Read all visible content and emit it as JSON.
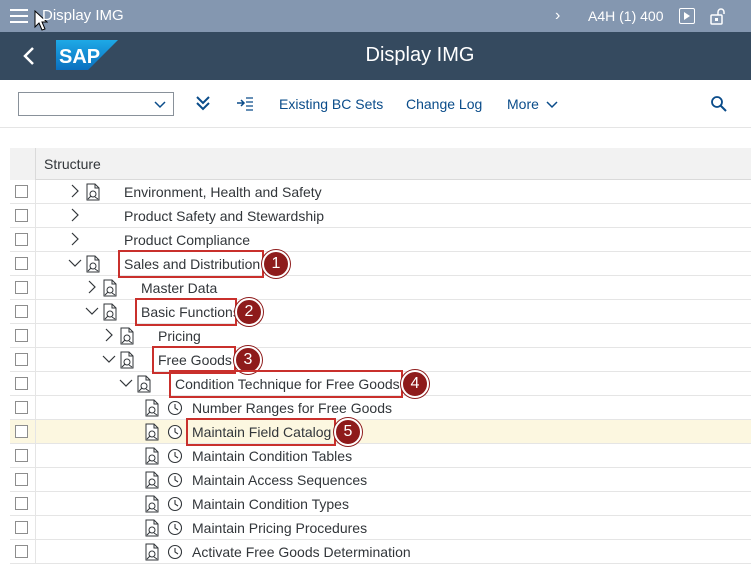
{
  "system_bar": {
    "title": "Display IMG",
    "system_info": "A4H (1) 400"
  },
  "header": {
    "logo_text": "SAP",
    "page_title": "Display IMG"
  },
  "toolbar": {
    "dropdown_value": "",
    "existing_bc_sets": "Existing BC Sets",
    "change_log": "Change Log",
    "more": "More"
  },
  "tree": {
    "column_header": "Structure",
    "rows": [
      {
        "label": "Environment, Health and Safety",
        "level": 0,
        "expander": "collapsed",
        "icon": "img-doc-icon"
      },
      {
        "label": "Product Safety and Stewardship",
        "level": 0,
        "expander": "collapsed",
        "icon": ""
      },
      {
        "label": "Product Compliance",
        "level": 0,
        "expander": "collapsed",
        "icon": ""
      },
      {
        "label": "Sales and Distribution",
        "level": 0,
        "expander": "expanded",
        "icon": "img-doc-icon"
      },
      {
        "label": "Master Data",
        "level": 1,
        "expander": "collapsed",
        "icon": "img-doc-icon"
      },
      {
        "label": "Basic Functions",
        "level": 1,
        "expander": "expanded",
        "icon": "img-doc-icon"
      },
      {
        "label": "Pricing",
        "level": 2,
        "expander": "collapsed",
        "icon": "img-doc-icon"
      },
      {
        "label": "Free Goods",
        "level": 2,
        "expander": "expanded",
        "icon": "img-doc-icon"
      },
      {
        "label": "Condition Technique for Free Goods",
        "level": 3,
        "expander": "expanded",
        "icon": "img-doc-icon"
      },
      {
        "label": "Number Ranges for Free Goods",
        "level": 4,
        "expander": "none",
        "icon": "execute-clock-icon"
      },
      {
        "label": "Maintain Field Catalog",
        "level": 4,
        "expander": "none",
        "icon": "execute-clock-icon",
        "selected": true
      },
      {
        "label": "Maintain Condition Tables",
        "level": 4,
        "expander": "none",
        "icon": "execute-clock-icon"
      },
      {
        "label": "Maintain Access Sequences",
        "level": 4,
        "expander": "none",
        "icon": "execute-clock-icon"
      },
      {
        "label": "Maintain Condition Types",
        "level": 4,
        "expander": "none",
        "icon": "execute-clock-icon"
      },
      {
        "label": "Maintain Pricing Procedures",
        "level": 4,
        "expander": "none",
        "icon": "execute-clock-icon"
      },
      {
        "label": "Activate Free Goods Determination",
        "level": 4,
        "expander": "none",
        "icon": "execute-clock-icon"
      }
    ]
  },
  "annotations": [
    "1",
    "2",
    "3",
    "4",
    "5"
  ],
  "colors": {
    "shell_bar": "#8497b0",
    "header_bar": "#354a5f",
    "link": "#0a4c8a",
    "annotation_box": "#c9302c",
    "annotation_badge": "#8e1b1b",
    "selected_row": "#fcf7e0"
  }
}
